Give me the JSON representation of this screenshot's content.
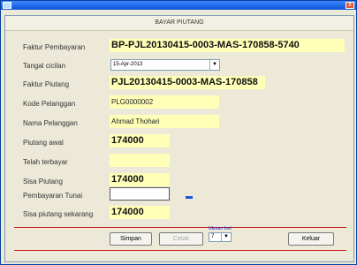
{
  "window": {
    "app_icon": "app-icon",
    "close_icon": "close-icon",
    "close_glyph": "x"
  },
  "panel": {
    "title": "BAYAR PIUTANG"
  },
  "form": {
    "faktur_pembayaran_label": "Faktur Pembayaran",
    "faktur_pembayaran_value": "BP-PJL20130415-0003-MAS-170858-5740",
    "tangal_cicilan_label": "Tangal cicilan",
    "tangal_cicilan_value": "15-Apr-2013",
    "faktur_piutang_label": "Faktur Piutang",
    "faktur_piutang_value": "PJL20130415-0003-MAS-170858",
    "kode_pelanggan_label": "Kode Pelanggan",
    "kode_pelanggan_value": "PLG0000002",
    "nama_pelanggan_label": "Nama Pelanggan",
    "nama_pelanggan_value": "Ahmad Thohari",
    "piutang_awal_label": "Piutang awal",
    "piutang_awal_value": "174000",
    "telah_terbayar_label": "Telah terbayar",
    "telah_terbayar_value": "",
    "sisa_piutang_label": "Sisa Piutang",
    "sisa_piutang_value": "174000",
    "pembayaran_tunai_label": "Pembayaran Tunai",
    "pembayaran_tunai_value": "",
    "sisa_sekarang_label": "Sisa piutang sekarang",
    "sisa_sekarang_value": "174000"
  },
  "footer": {
    "simpan_label": "Simpan",
    "cetak_label": "Cetak",
    "ukuran_font_label": "Ukuran font",
    "ukuran_font_value": "7",
    "keluar_label": "Keluar"
  },
  "colors": {
    "field_bg": "#ffffb8",
    "accent_red": "#cc2020",
    "title_blue": "#0a55d8"
  }
}
